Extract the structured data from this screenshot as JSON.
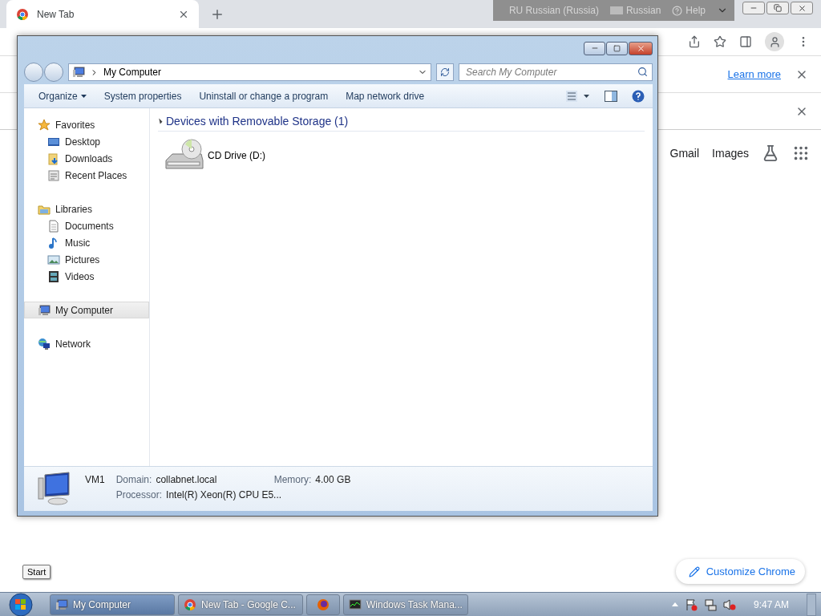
{
  "browser": {
    "tab": {
      "title": "New Tab",
      "selected": true
    },
    "language_bar": [
      {
        "kind": "lang",
        "label": "RU Russian (Russia)"
      },
      {
        "kind": "keyboard",
        "label": "Russian"
      },
      {
        "kind": "help",
        "label": "Help"
      }
    ],
    "infobar": {
      "link": "Learn more"
    },
    "header_links": [
      "Gmail",
      "Images"
    ],
    "customize_button": "Customize Chrome"
  },
  "explorer": {
    "address": "My Computer",
    "search": {
      "placeholder": "Search My Computer"
    },
    "commands": [
      {
        "label": "Organize",
        "dropdown": true
      },
      {
        "label": "System properties",
        "dropdown": false
      },
      {
        "label": "Uninstall or change a program",
        "dropdown": false
      },
      {
        "label": "Map network drive",
        "dropdown": false
      }
    ],
    "nav": [
      {
        "label": "Favorites",
        "selected": false,
        "children": [
          {
            "label": "Desktop",
            "selected": false
          },
          {
            "label": "Downloads",
            "selected": false
          },
          {
            "label": "Recent Places",
            "selected": false
          }
        ]
      },
      {
        "label": "Libraries",
        "selected": false,
        "children": [
          {
            "label": "Documents",
            "selected": false
          },
          {
            "label": "Music",
            "selected": false
          },
          {
            "label": "Pictures",
            "selected": false
          },
          {
            "label": "Videos",
            "selected": false
          }
        ]
      },
      {
        "label": "My Computer",
        "selected": true
      },
      {
        "label": "Network",
        "selected": false
      }
    ],
    "groups": [
      {
        "title": "Devices with Removable Storage (1)",
        "expanded": true,
        "items": [
          {
            "label": "CD Drive (D:)"
          }
        ]
      }
    ],
    "details": {
      "name": "VM1",
      "fields": [
        {
          "label": "Domain:",
          "value": "collabnet.local"
        },
        {
          "label": "Memory:",
          "value": "4.00 GB"
        },
        {
          "label": "Processor:",
          "value": "Intel(R) Xeon(R) CPU E5..."
        }
      ]
    }
  },
  "tooltip": "Start",
  "taskbar": {
    "buttons": [
      {
        "label": "My Computer",
        "selected": true
      },
      {
        "label": "New Tab - Google C...",
        "selected": false
      },
      {
        "selected": false
      },
      {
        "label": "Windows Task Mana...",
        "selected": false
      }
    ],
    "clock": "9:47 AM"
  }
}
